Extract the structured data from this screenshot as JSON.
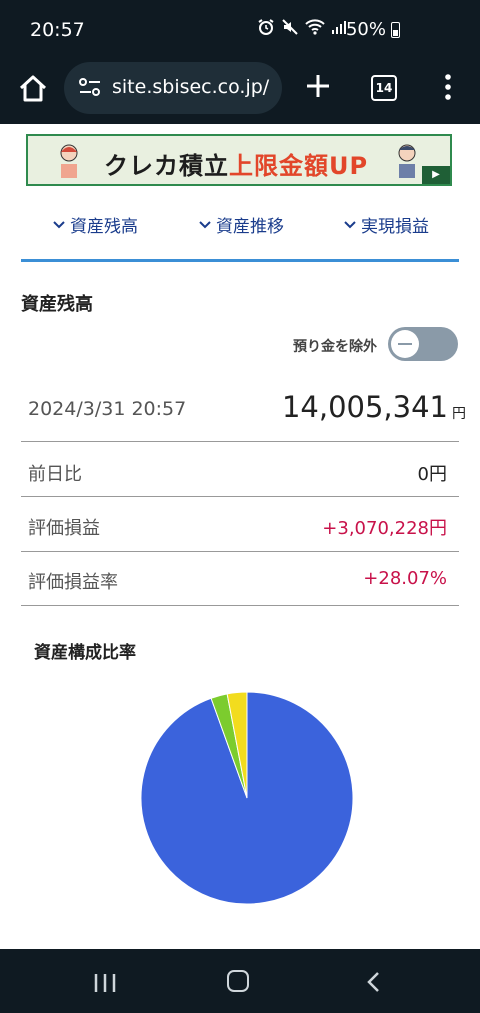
{
  "status_bar": {
    "time": "20:57",
    "battery": "50%",
    "icons": [
      "alarm-icon",
      "mute-icon",
      "wifi-icon",
      "signal-icon",
      "battery-icon"
    ]
  },
  "browser": {
    "url": "site.sbisec.co.jp/",
    "tab_count": "14",
    "icons": [
      "home-icon",
      "site-settings-icon",
      "new-tab-icon",
      "tab-switcher-icon",
      "more-menu-icon"
    ]
  },
  "banner": {
    "text_main": "クレカ積立",
    "text_highlight": "上限金額UP",
    "play_label": "▶"
  },
  "nav_links": [
    {
      "label": "資産残高"
    },
    {
      "label": "資産推移"
    },
    {
      "label": "実現損益"
    }
  ],
  "balance": {
    "section_title": "資産残高",
    "toggle_label": "預り金を除外",
    "toggle_on": false,
    "datetime": "2024/3/31 20:57",
    "total": "14,005,341",
    "total_unit": "円",
    "rows": [
      {
        "label": "前日比",
        "value": "0円"
      },
      {
        "label": "評価損益",
        "value": "+3,070,228円"
      },
      {
        "label": "評価損益率",
        "value": "+28.07%"
      }
    ]
  },
  "composition": {
    "title": "資産構成比率"
  },
  "colors": {
    "chart_blue": "#3b63dc",
    "chart_green": "#7ccc2e",
    "chart_yellow": "#f2dc1e",
    "positive": "#c8124a",
    "accent": "#3b8fd6"
  },
  "chart_data": {
    "type": "pie",
    "values": [
      94.5,
      2.5,
      3.0
    ],
    "colors": [
      "#3b63dc",
      "#7ccc2e",
      "#f2dc1e"
    ]
  }
}
